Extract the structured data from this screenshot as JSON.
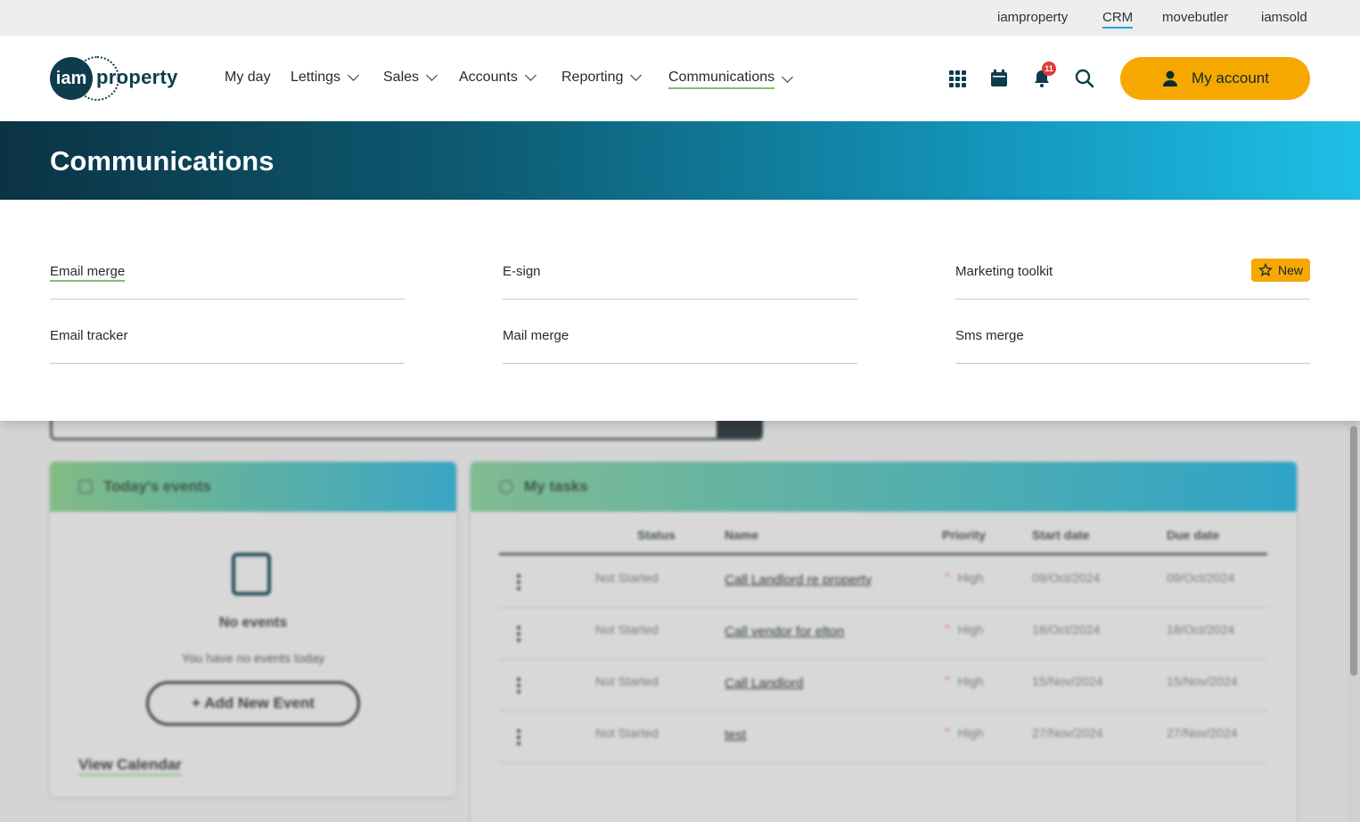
{
  "utility": {
    "links": [
      "iamproperty",
      "CRM",
      "movebutler",
      "iamsold"
    ]
  },
  "brand": {
    "logo_left": "iam",
    "logo_right": "property"
  },
  "nav": {
    "items": [
      "My day",
      "Lettings",
      "Sales",
      "Accounts",
      "Reporting",
      "Communications"
    ],
    "notification_count": "11",
    "account_label": "My account"
  },
  "icons": {
    "apps": "apps-grid-icon",
    "calendar": "calendar-icon",
    "notifications": "bell-icon",
    "search": "search-icon",
    "user": "user-icon"
  },
  "banner": {
    "title": "Communications"
  },
  "menu": {
    "col1": [
      "Email merge",
      "Email tracker"
    ],
    "col2": [
      "E-sign",
      "Mail merge"
    ],
    "col3": [
      "Marketing toolkit",
      "Sms merge"
    ],
    "new_badge": "New"
  },
  "events": {
    "title": "Today's events",
    "empty_title": "No events",
    "empty_sub": "You have no events today",
    "add_label": "+ Add New Event",
    "view_label": "View Calendar"
  },
  "tasks": {
    "title": "My tasks",
    "columns": [
      "Status",
      "Name",
      "Priority",
      "Start date",
      "Due date"
    ],
    "rows": [
      [
        "Not Started",
        "Call Landlord re property",
        "High",
        "09/Oct/2024",
        "09/Oct/2024"
      ],
      [
        "Not Started",
        "Call vendor for elton",
        "High",
        "18/Oct/2024",
        "18/Oct/2024"
      ],
      [
        "Not Started",
        "Call Landlord",
        "High",
        "15/Nov/2024",
        "15/Nov/2024"
      ],
      [
        "Not Started",
        "test",
        "High",
        "27/Nov/2024",
        "27/Nov/2024"
      ]
    ]
  },
  "colors": {
    "brand_dark": "#0d3d4d",
    "accent_orange": "#f6a800",
    "active_underline": "#7ac36a",
    "banner_end": "#1fbfe6",
    "badge_red": "#e23a3a"
  }
}
